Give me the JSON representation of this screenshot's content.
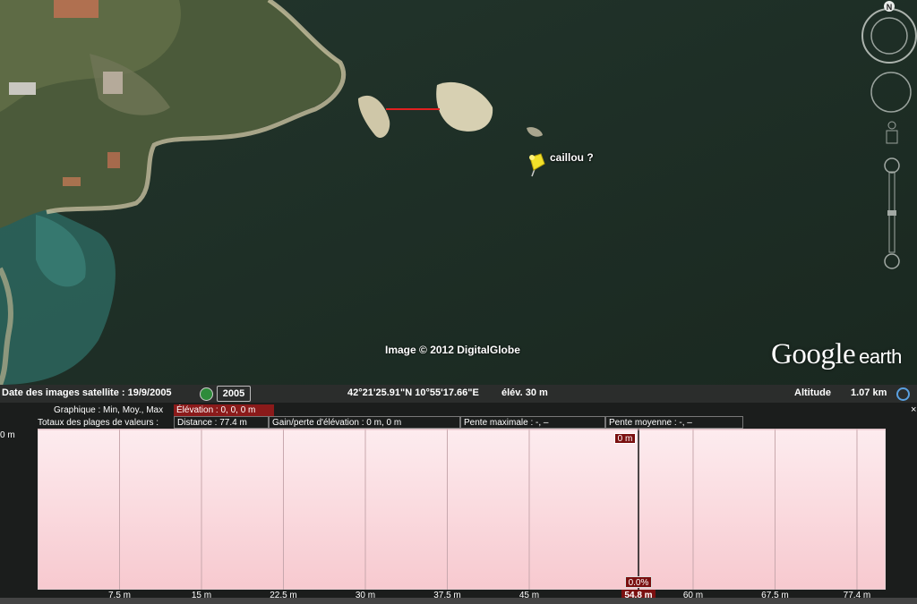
{
  "map": {
    "placemark_label": "caillou ?",
    "copyright": "Image © 2012 DigitalGlobe",
    "logo_google": "Google",
    "logo_earth": "earth",
    "compass_north": "N"
  },
  "status": {
    "imagery_date": "Date des images satellite : 19/9/2005",
    "year": "2005",
    "coordinates": "42°21'25.91\"N  10°55'17.66\"E",
    "elevation": "élév.   30 m",
    "altitude_label": "Altitude",
    "altitude_value": "1.07 km"
  },
  "profile": {
    "y_label": "0 m",
    "graph_label": "Graphique : Min, Moy., Max",
    "elevation_label": "Élévation : 0, 0, 0 m",
    "totals_label": "Totaux des plages de valeurs :",
    "distance": "Distance : 77.4 m",
    "gain_loss": "Gain/perte d'élévation : 0 m, 0 m",
    "max_slope": "Pente maximale : -, –",
    "avg_slope": "Pente moyenne : -, –",
    "marker_elevation": "0 m",
    "marker_slope": "0.0%",
    "marker_distance": "54.8 m",
    "close": "×"
  },
  "chart_data": {
    "type": "area",
    "x_ticks": [
      "7.5 m",
      "15 m",
      "22.5 m",
      "30 m",
      "37.5 m",
      "45 m",
      "54.8 m",
      "60 m",
      "67.5 m",
      "77.4 m"
    ],
    "x": [
      0,
      77.4
    ],
    "values": [
      0,
      0
    ],
    "xlim": [
      0,
      77.4
    ],
    "ylabel": "0 m",
    "fill_color": "#f7c9cf",
    "cursor_x": 54.8,
    "grid": true
  }
}
